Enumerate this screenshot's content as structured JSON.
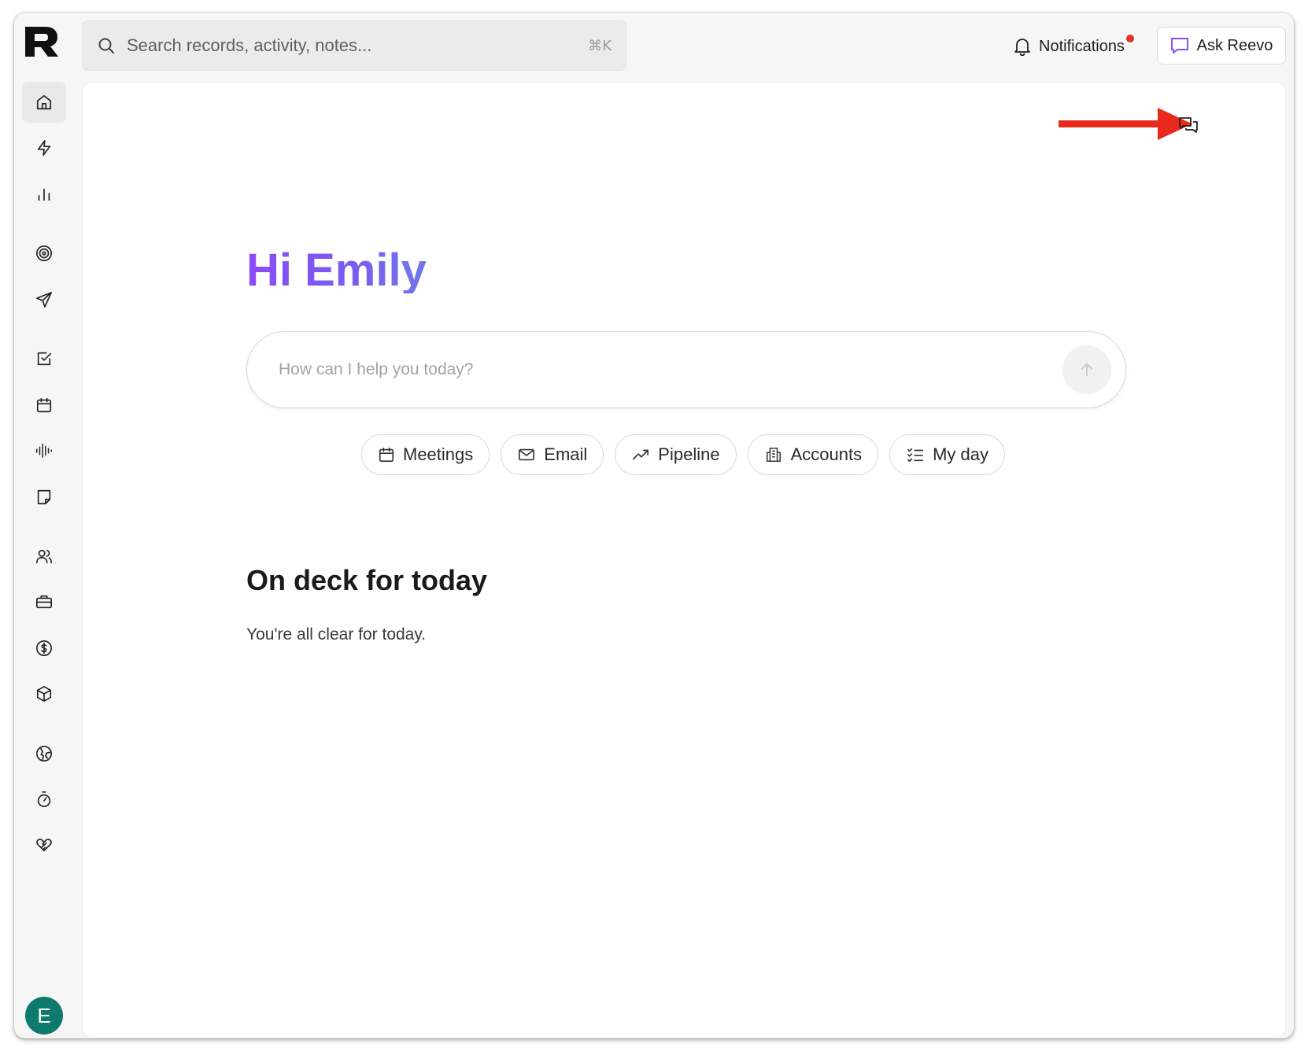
{
  "app": {
    "logo_name": "reevo-logo"
  },
  "header": {
    "search": {
      "placeholder": "Search records, activity, notes...",
      "shortcut": "⌘K"
    },
    "notifications": {
      "label": "Notifications",
      "has_unread": true
    },
    "ask_button": {
      "label": "Ask Reevo"
    }
  },
  "sidebar": {
    "items": [
      {
        "icon": "home-icon",
        "active": true
      },
      {
        "icon": "lightning-icon"
      },
      {
        "icon": "bar-chart-icon"
      },
      {
        "icon": "target-icon"
      },
      {
        "icon": "send-icon"
      },
      {
        "icon": "checkbox-icon"
      },
      {
        "icon": "calendar-icon"
      },
      {
        "icon": "audio-wave-icon"
      },
      {
        "icon": "note-icon"
      },
      {
        "icon": "users-icon"
      },
      {
        "icon": "briefcase-icon"
      },
      {
        "icon": "dollar-icon"
      },
      {
        "icon": "package-icon"
      },
      {
        "icon": "globe-icon"
      },
      {
        "icon": "timer-icon"
      },
      {
        "icon": "handshake-icon"
      }
    ],
    "avatar_initial": "E"
  },
  "main": {
    "greeting": "Hi Emily",
    "prompt": {
      "placeholder": "How can I help you today?"
    },
    "chips": [
      {
        "label": "Meetings",
        "icon": "calendar-icon"
      },
      {
        "label": "Email",
        "icon": "mail-icon"
      },
      {
        "label": "Pipeline",
        "icon": "trend-up-icon"
      },
      {
        "label": "Accounts",
        "icon": "building-icon"
      },
      {
        "label": "My day",
        "icon": "checklist-icon"
      }
    ],
    "section_title": "On deck for today",
    "section_empty": "You're all clear for today."
  },
  "colors": {
    "accent_purple": "#8d4bf6",
    "notification_dot": "#e5322d",
    "avatar_bg": "#0e7a6b",
    "annotation_arrow": "#e8291c"
  }
}
